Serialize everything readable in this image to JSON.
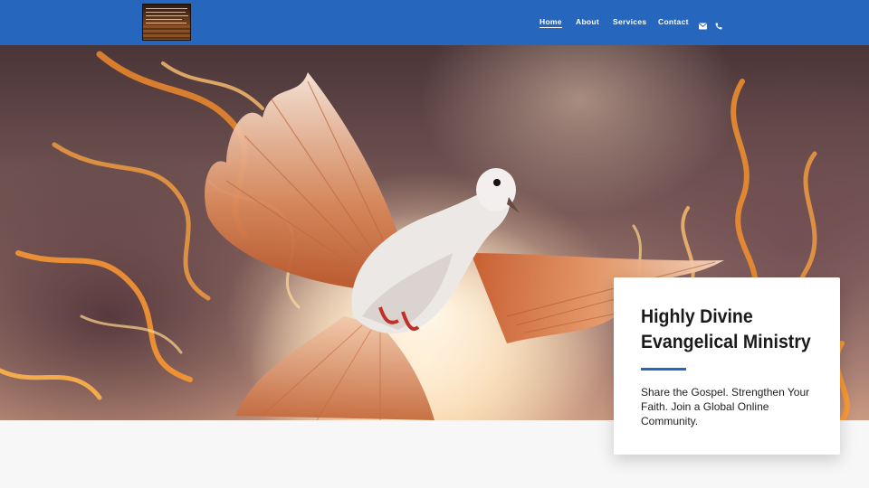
{
  "site": {
    "logo_icon": "ministry-logo-image",
    "brand_color": "#2667bd"
  },
  "nav": {
    "items": [
      {
        "label": "Home",
        "active": true
      },
      {
        "label": "About",
        "active": false
      },
      {
        "label": "Services",
        "active": false
      },
      {
        "label": "Contact",
        "active": false
      }
    ],
    "icons": [
      "envelope-icon",
      "phone-icon"
    ]
  },
  "hero": {
    "image": "flaming-dove-illustration"
  },
  "card": {
    "title": "Highly Divine Evangelical Ministry",
    "tagline": "Share the Gospel. Strengthen Your Faith. Join a Global Online Community."
  }
}
